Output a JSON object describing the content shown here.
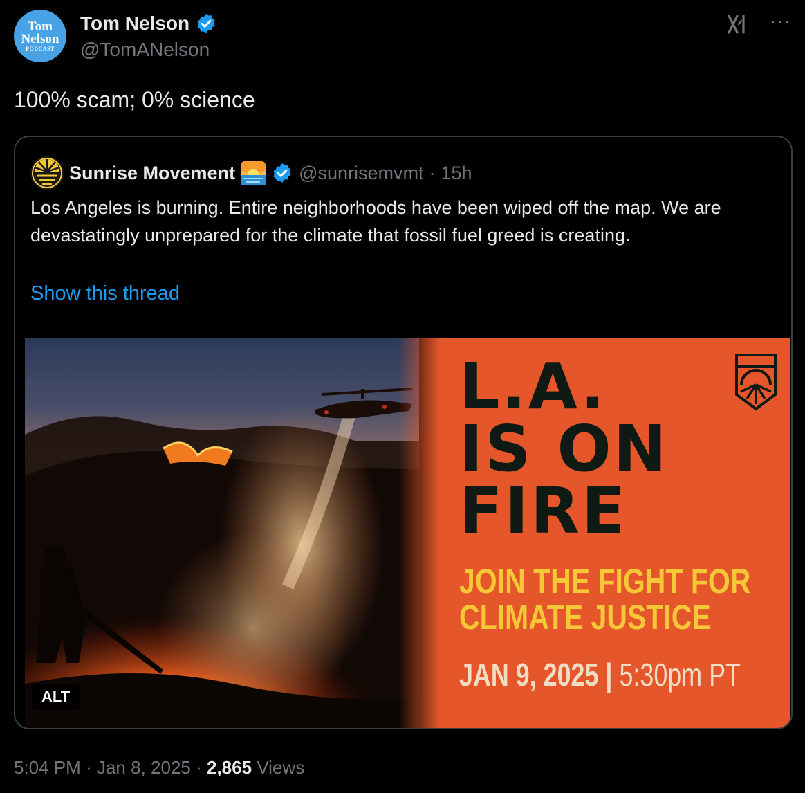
{
  "author": {
    "avatar_line1": "Tom",
    "avatar_line2": "Nelson",
    "avatar_line3": "PODCAST",
    "name": "Tom Nelson",
    "handle": "@TomANelson"
  },
  "tweet": {
    "text": "100% scam; 0% science"
  },
  "quoted": {
    "name": "Sunrise Movement",
    "handle": "@sunrisemvmt",
    "separator": "·",
    "time": "15h",
    "text": "Los Angeles is burning. Entire neighborhoods have been wiped off the map. We are devastatingly unprepared for the climate that fossil fuel greed is creating.",
    "show_thread": "Show this thread",
    "media": {
      "alt_label": "ALT",
      "poster_title_line1": "L.A.",
      "poster_title_line2": "IS ON",
      "poster_title_line3": "FIRE",
      "poster_sub_line1": "JOIN THE FIGHT FOR",
      "poster_sub_line2": "CLIMATE JUSTICE",
      "poster_date": "JAN 9, 2025",
      "poster_date_sep": "|",
      "poster_time": "5:30pm PT"
    }
  },
  "meta": {
    "time": "5:04 PM",
    "sep1": "·",
    "date": "Jan 8, 2025",
    "sep2": "·",
    "views_count": "2,865",
    "views_label": "Views"
  },
  "icons": {
    "more": "more-icon",
    "grok": "grok-icon",
    "verified": "verified-badge-icon"
  },
  "colors": {
    "background": "#000000",
    "text": "#e7e9ea",
    "muted": "#71767b",
    "link": "#1d9bf0",
    "verified": "#1d9bf0",
    "poster_orange": "#e5572b",
    "poster_yellow": "#f6c737"
  }
}
